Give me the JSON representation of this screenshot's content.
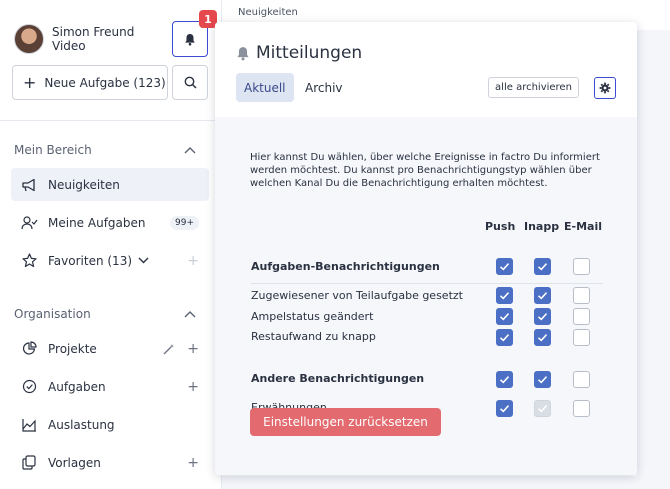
{
  "user": {
    "name": "Simon Freund",
    "subtitle": "Video"
  },
  "notifications_badge": "1",
  "new_task_label": "Neue Aufgabe (123)",
  "sections": {
    "mein_bereich": "Mein Bereich",
    "organisation": "Organisation"
  },
  "nav": {
    "neuigkeiten": "Neuigkeiten",
    "meine_aufgaben": "Meine Aufgaben",
    "meine_aufgaben_count": "99+",
    "favoriten": "Favoriten (13)",
    "projekte": "Projekte",
    "aufgaben": "Aufgaben",
    "auslastung": "Auslastung",
    "vorlagen": "Vorlagen"
  },
  "breadcrumb": "Neuigkeiten",
  "popover": {
    "title": "Mitteilungen",
    "tabs": [
      "Aktuell",
      "Archiv"
    ],
    "archive_all": "alle archivieren",
    "description": "Hier kannst Du wählen, über welche Ereignisse in factro Du informiert werden möchtest. Du kannst pro Benachrichtigungstyp wählen über welchen Kanal Du die Benachrichtigung erhalten möchtest.",
    "columns": [
      "Push",
      "Inapp",
      "E-Mail"
    ],
    "rows": [
      {
        "label": "Aufgaben-Benachrichtigungen",
        "bold": true,
        "push": true,
        "inapp": true,
        "email": false
      },
      {
        "label": "Zugewiesener von Teilaufgabe gesetzt",
        "bold": false,
        "push": true,
        "inapp": true,
        "email": false
      },
      {
        "label": "Ampelstatus geändert",
        "bold": false,
        "push": true,
        "inapp": true,
        "email": false
      },
      {
        "label": "Restaufwand zu knapp",
        "bold": false,
        "push": true,
        "inapp": true,
        "email": false
      },
      {
        "label": "Andere Benachrichtigungen",
        "bold": true,
        "push": true,
        "inapp": true,
        "email": false
      },
      {
        "label": "Erwähnungen",
        "bold": false,
        "push": true,
        "inapp": "disabled-checked",
        "email": false
      }
    ],
    "reset_label": "Einstellungen zurücksetzen"
  },
  "colors": {
    "accent": "#3b4bd4",
    "checkbox_on": "#4a6fc4",
    "danger": "#e36a6e",
    "badge": "#e5484d"
  }
}
